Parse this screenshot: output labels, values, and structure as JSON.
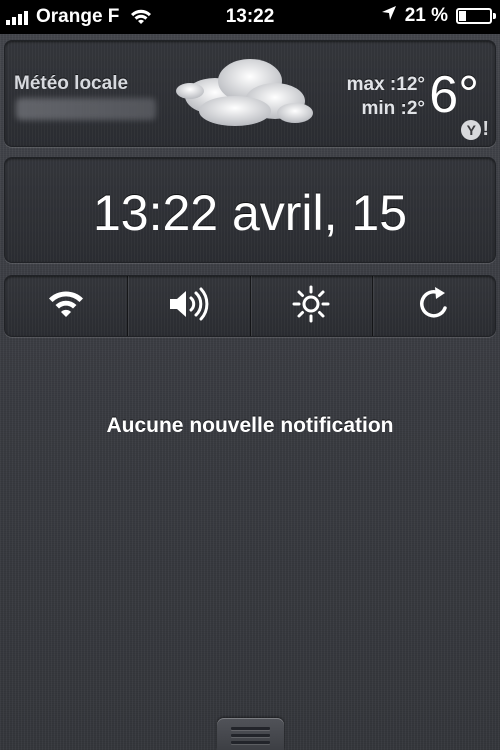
{
  "status_bar": {
    "carrier": "Orange F",
    "time": "13:22",
    "battery": "21 %",
    "battery_level": 0.21,
    "signal_bars": 4,
    "icons": [
      "signal-icon",
      "wifi-icon",
      "location-icon",
      "battery-icon"
    ]
  },
  "weather": {
    "title": "Météo locale",
    "max_label": "max :12°",
    "min_label": "min :2°",
    "current_temp": "6°",
    "condition_icon": "cloud-icon",
    "provider_icon": "yahoo-icon"
  },
  "clock": {
    "text": "13:22 avril, 15"
  },
  "toggles": [
    {
      "name": "wifi-toggle",
      "icon": "wifi-icon"
    },
    {
      "name": "sound-toggle",
      "icon": "speaker-icon"
    },
    {
      "name": "brightness-toggle",
      "icon": "sun-icon"
    },
    {
      "name": "rotation-toggle",
      "icon": "rotate-icon"
    }
  ],
  "notifications": {
    "empty_message": "Aucune nouvelle notification"
  },
  "colors": {
    "background": "#3a3c42",
    "panel": "#2c2e33",
    "text": "#ffffff"
  }
}
